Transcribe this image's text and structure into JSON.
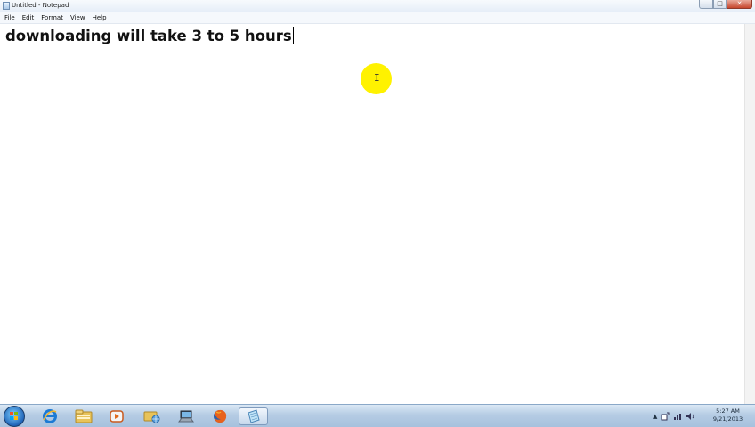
{
  "window": {
    "title": "Untitled - Notepad",
    "min_glyph": "–",
    "max_glyph": "□",
    "close_glyph": "✕"
  },
  "menu": {
    "items": [
      "File",
      "Edit",
      "Format",
      "View",
      "Help"
    ]
  },
  "editor": {
    "text": "downloading will take 3 to 5 hours"
  },
  "taskbar": {
    "pinned": [
      {
        "name": "internet-explorer-icon"
      },
      {
        "name": "windows-explorer-icon"
      },
      {
        "name": "media-player-icon"
      },
      {
        "name": "network-folder-icon"
      },
      {
        "name": "computer-icon"
      },
      {
        "name": "firefox-icon"
      },
      {
        "name": "notepad-icon",
        "active": true
      }
    ],
    "tray": {
      "show_hidden_glyph": "▲"
    },
    "clock": {
      "time": "5:27 AM",
      "date": "9/21/2013"
    }
  },
  "colors": {
    "cursor_highlight": "#fff200",
    "taskbar": "#b5cce4",
    "close_button": "#c7462d"
  }
}
